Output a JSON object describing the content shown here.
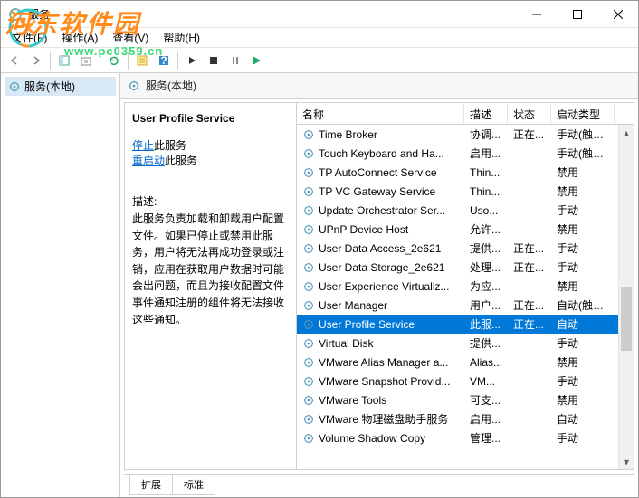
{
  "window": {
    "title": "服务"
  },
  "menubar": {
    "file": "文件(F)",
    "action": "操作(A)",
    "view": "查看(V)",
    "help": "帮助(H)"
  },
  "tree": {
    "root": "服务(本地)"
  },
  "content_header": "服务(本地)",
  "detail": {
    "name": "User Profile Service",
    "stop_label": "停止",
    "stop_suffix": "此服务",
    "restart_label": "重启动",
    "restart_suffix": "此服务",
    "desc_label": "描述:",
    "desc": "此服务负责加载和卸载用户配置文件。如果已停止或禁用此服务，用户将无法再成功登录或注销，应用在获取用户数据时可能会出问题，而且为接收配置文件事件通知注册的组件将无法接收这些通知。"
  },
  "columns": {
    "name": "名称",
    "desc": "描述",
    "state": "状态",
    "start": "启动类型"
  },
  "services": [
    {
      "name": "Time Broker",
      "desc": "协调...",
      "state": "正在...",
      "start": "手动(触发..."
    },
    {
      "name": "Touch Keyboard and Ha...",
      "desc": "启用...",
      "state": "",
      "start": "手动(触发..."
    },
    {
      "name": "TP AutoConnect Service",
      "desc": "Thin...",
      "state": "",
      "start": "禁用"
    },
    {
      "name": "TP VC Gateway Service",
      "desc": "Thin...",
      "state": "",
      "start": "禁用"
    },
    {
      "name": "Update Orchestrator Ser...",
      "desc": "Uso...",
      "state": "",
      "start": "手动"
    },
    {
      "name": "UPnP Device Host",
      "desc": "允许...",
      "state": "",
      "start": "禁用"
    },
    {
      "name": "User Data Access_2e621",
      "desc": "提供...",
      "state": "正在...",
      "start": "手动"
    },
    {
      "name": "User Data Storage_2e621",
      "desc": "处理...",
      "state": "正在...",
      "start": "手动"
    },
    {
      "name": "User Experience Virtualiz...",
      "desc": "为应...",
      "state": "",
      "start": "禁用"
    },
    {
      "name": "User Manager",
      "desc": "用户...",
      "state": "正在...",
      "start": "自动(触发..."
    },
    {
      "name": "User Profile Service",
      "desc": "此服...",
      "state": "正在...",
      "start": "自动",
      "selected": true
    },
    {
      "name": "Virtual Disk",
      "desc": "提供...",
      "state": "",
      "start": "手动"
    },
    {
      "name": "VMware Alias Manager a...",
      "desc": "Alias...",
      "state": "",
      "start": "禁用"
    },
    {
      "name": "VMware Snapshot Provid...",
      "desc": "VM...",
      "state": "",
      "start": "手动"
    },
    {
      "name": "VMware Tools",
      "desc": "可支...",
      "state": "",
      "start": "禁用"
    },
    {
      "name": "VMware 物理磁盘助手服务",
      "desc": "启用...",
      "state": "",
      "start": "自动"
    },
    {
      "name": "Volume Shadow Copy",
      "desc": "管理...",
      "state": "",
      "start": "手动"
    }
  ],
  "tabs": {
    "extended": "扩展",
    "standard": "标准"
  },
  "watermark": {
    "text": "河东软件园",
    "sub": "www.pc0359.cn"
  }
}
